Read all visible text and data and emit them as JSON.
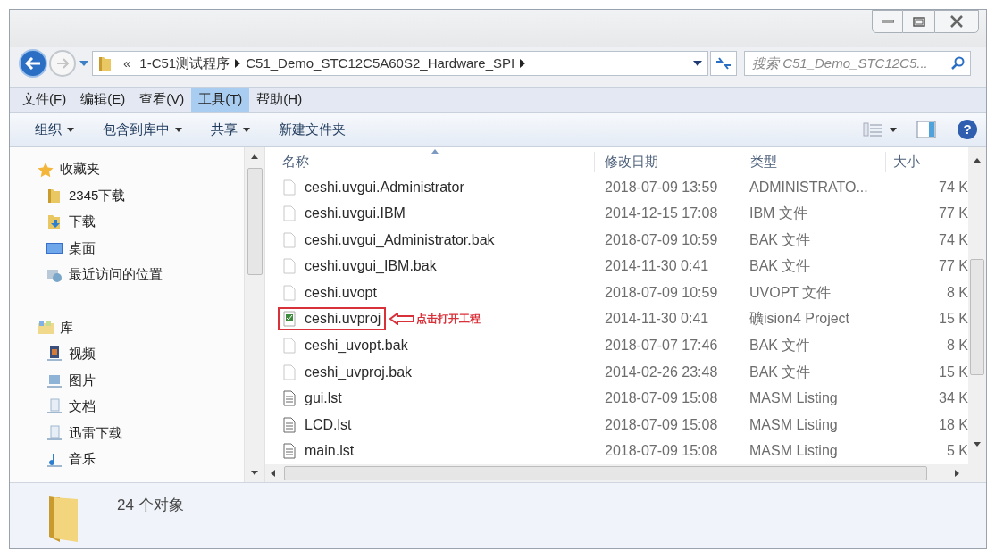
{
  "address": {
    "overflow": "«",
    "crumbs": [
      "1-C51测试程序",
      "C51_Demo_STC12C5A60S2_Hardware_SPI"
    ]
  },
  "search": {
    "placeholder": "搜索 C51_Demo_STC12C5..."
  },
  "menu": [
    {
      "label": "文件(F)",
      "selected": false
    },
    {
      "label": "编辑(E)",
      "selected": false
    },
    {
      "label": "查看(V)",
      "selected": false
    },
    {
      "label": "工具(T)",
      "selected": true
    },
    {
      "label": "帮助(H)",
      "selected": false
    }
  ],
  "toolbar": {
    "items": [
      {
        "label": "组织",
        "dropdown": true
      },
      {
        "label": "包含到库中",
        "dropdown": true
      },
      {
        "label": "共享",
        "dropdown": true
      },
      {
        "label": "新建文件夹",
        "dropdown": false
      }
    ],
    "help": "?"
  },
  "sidebar": {
    "groups": [
      {
        "label": "收藏夹",
        "kind": "star",
        "children": [
          {
            "label": "2345下载",
            "kind": "folder"
          },
          {
            "label": "下载",
            "kind": "download"
          },
          {
            "label": "桌面",
            "kind": "desktop"
          },
          {
            "label": "最近访问的位置",
            "kind": "recent"
          }
        ]
      },
      {
        "label": "库",
        "kind": "library",
        "children": [
          {
            "label": "视频",
            "kind": "video"
          },
          {
            "label": "图片",
            "kind": "pictures"
          },
          {
            "label": "文档",
            "kind": "documents"
          },
          {
            "label": "迅雷下载",
            "kind": "documents"
          },
          {
            "label": "音乐",
            "kind": "music"
          }
        ]
      }
    ]
  },
  "table": {
    "columns": [
      "名称",
      "修改日期",
      "类型",
      "大小"
    ],
    "rows": [
      {
        "name": "ceshi.uvgui.Administrator",
        "date": "2018-07-09 13:59",
        "type": "ADMINISTRATO...",
        "size": "74 K",
        "kind": "blank",
        "highlighted": false
      },
      {
        "name": "ceshi.uvgui.IBM",
        "date": "2014-12-15 17:08",
        "type": "IBM 文件",
        "size": "77 K",
        "kind": "blank",
        "highlighted": false
      },
      {
        "name": "ceshi.uvgui_Administrator.bak",
        "date": "2018-07-09 10:59",
        "type": "BAK 文件",
        "size": "74 K",
        "kind": "blank",
        "highlighted": false
      },
      {
        "name": "ceshi.uvgui_IBM.bak",
        "date": "2014-11-30 0:41",
        "type": "BAK 文件",
        "size": "77 K",
        "kind": "blank",
        "highlighted": false
      },
      {
        "name": "ceshi.uvopt",
        "date": "2018-07-09 10:59",
        "type": "UVOPT 文件",
        "size": "8 K",
        "kind": "blank",
        "highlighted": false
      },
      {
        "name": "ceshi.uvproj",
        "date": "2014-11-30 0:41",
        "type": "礦ision4 Project",
        "size": "15 K",
        "kind": "project",
        "highlighted": true,
        "annotation": "点击打开工程"
      },
      {
        "name": "ceshi_uvopt.bak",
        "date": "2018-07-07 17:46",
        "type": "BAK 文件",
        "size": "8 K",
        "kind": "blank",
        "highlighted": false
      },
      {
        "name": "ceshi_uvproj.bak",
        "date": "2014-02-26 23:48",
        "type": "BAK 文件",
        "size": "15 K",
        "kind": "blank",
        "highlighted": false
      },
      {
        "name": "gui.lst",
        "date": "2018-07-09 15:08",
        "type": "MASM Listing",
        "size": "34 K",
        "kind": "listing",
        "highlighted": false
      },
      {
        "name": "LCD.lst",
        "date": "2018-07-09 15:08",
        "type": "MASM Listing",
        "size": "18 K",
        "kind": "listing",
        "highlighted": false
      },
      {
        "name": "main.lst",
        "date": "2018-07-09 15:08",
        "type": "MASM Listing",
        "size": "5 K",
        "kind": "listing",
        "highlighted": false
      }
    ]
  },
  "status_bar": {
    "count": "24 个对象"
  }
}
